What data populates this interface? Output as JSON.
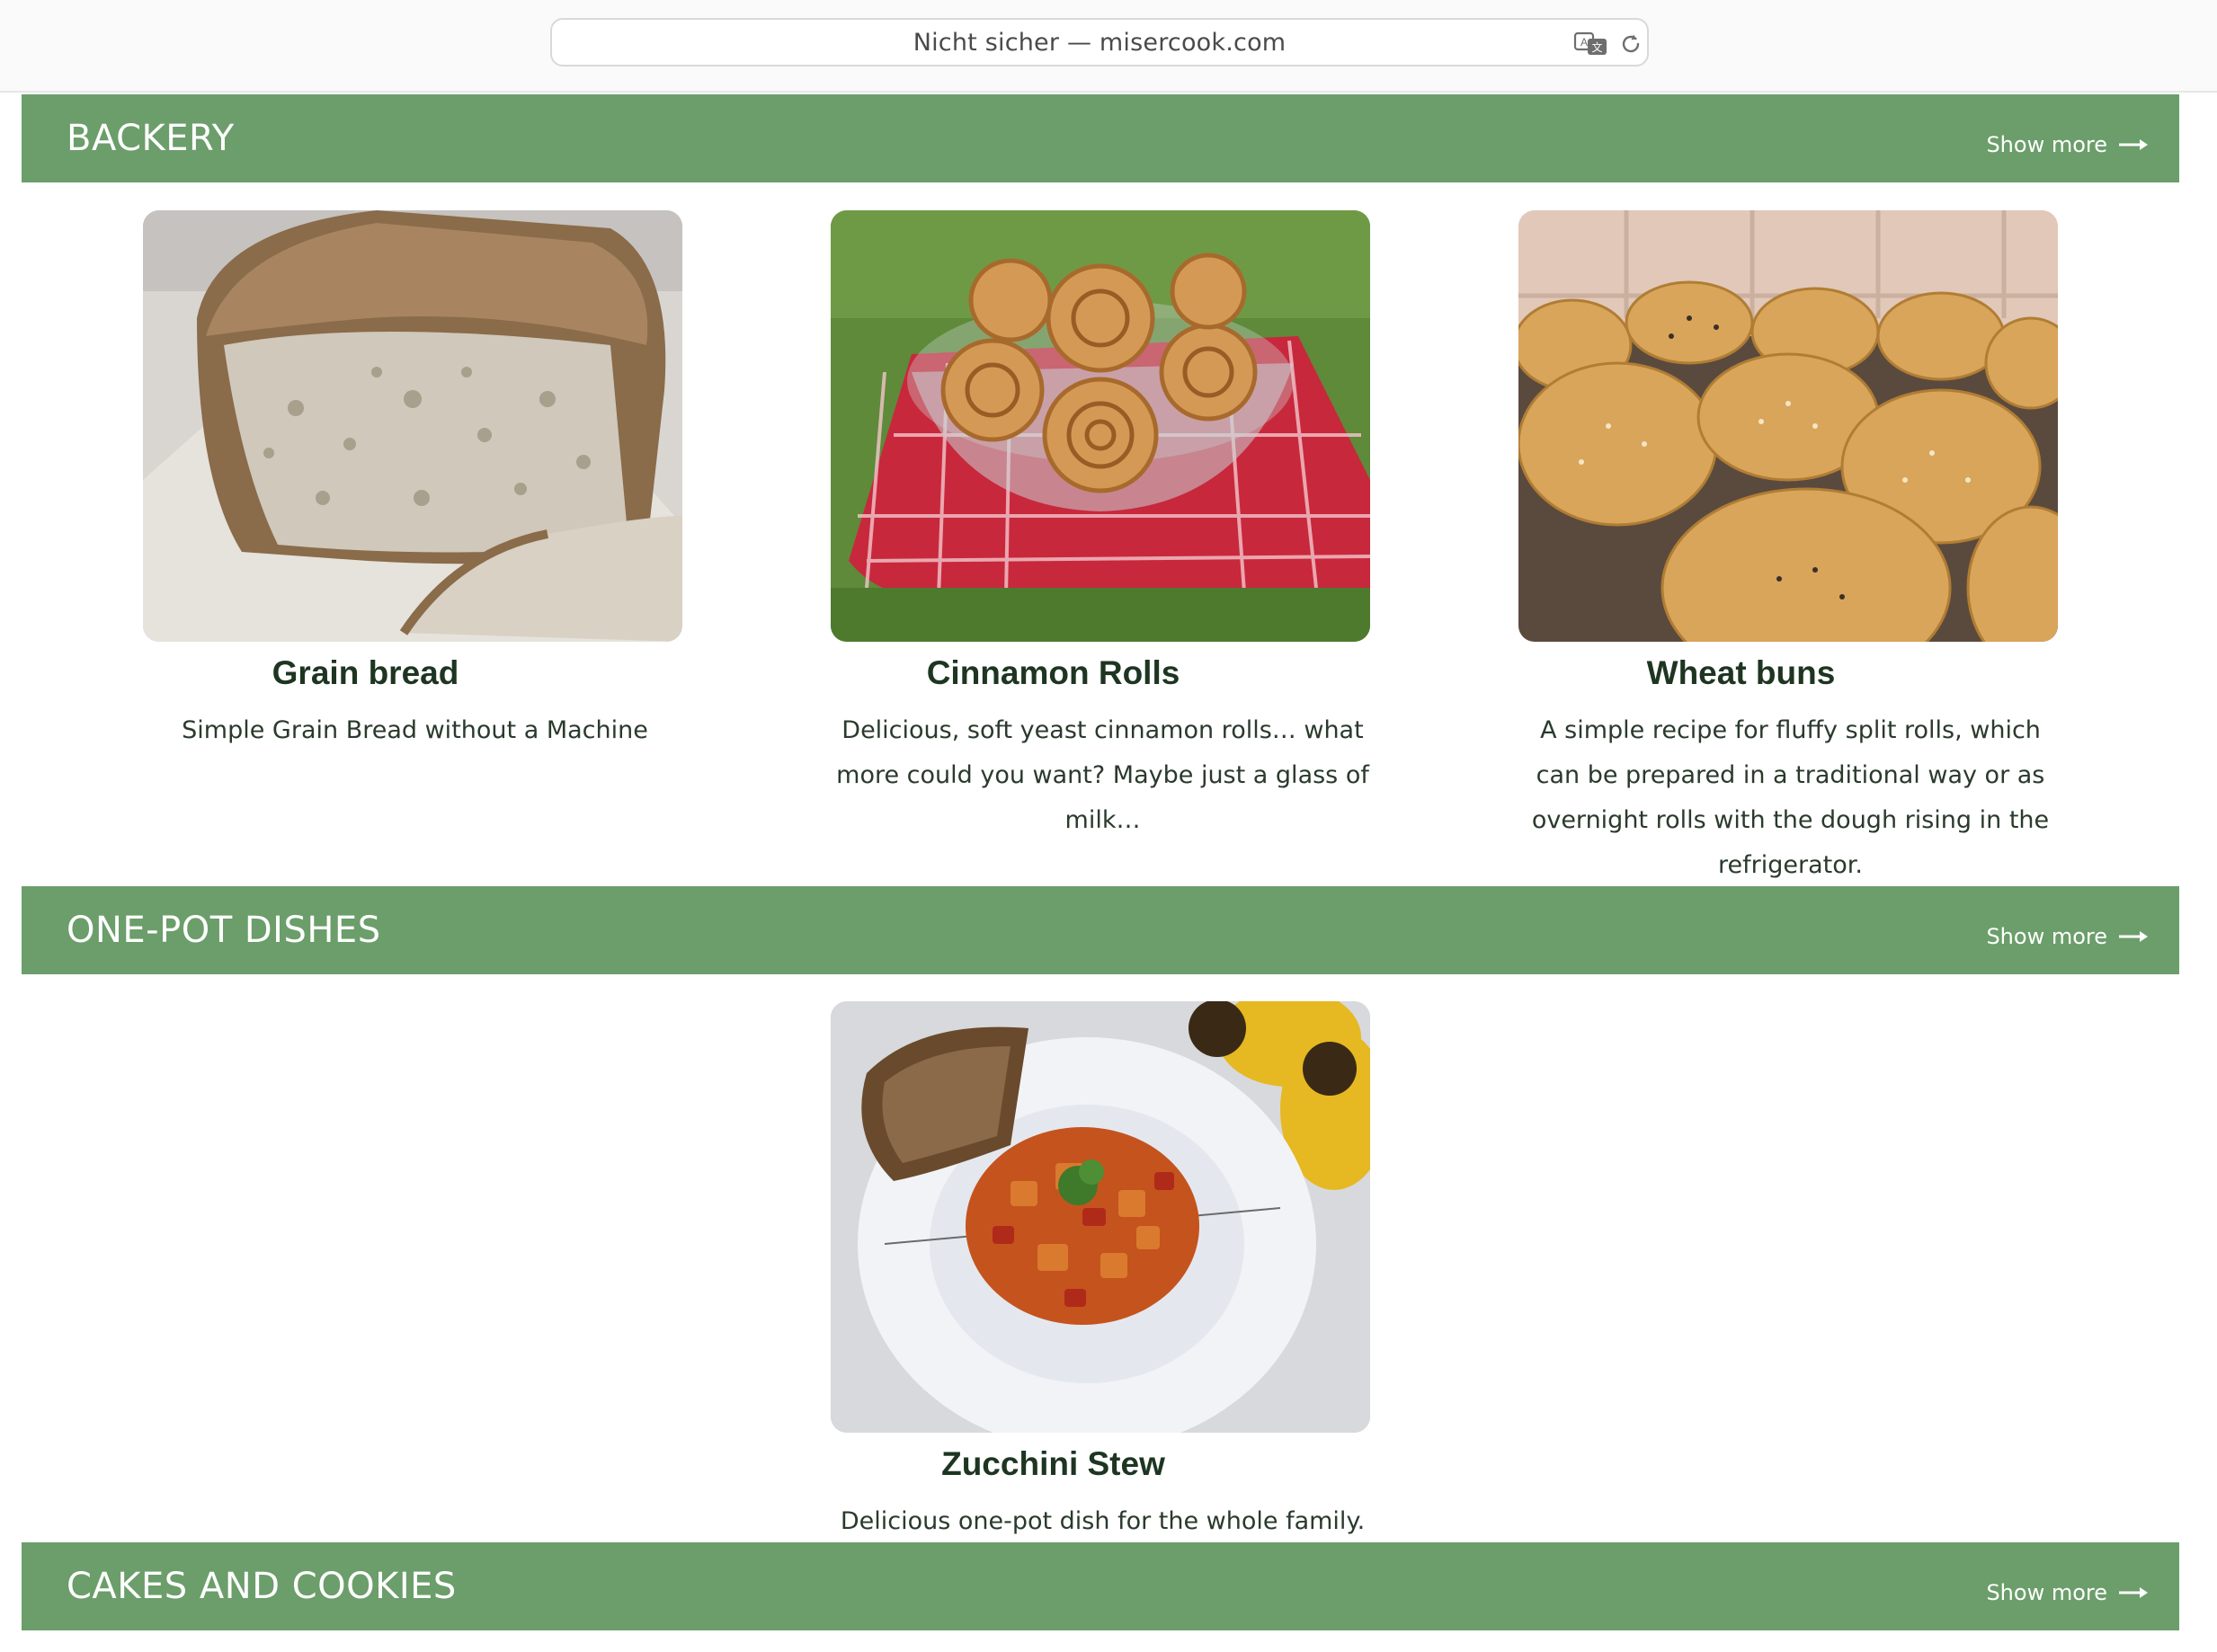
{
  "browser": {
    "address": "Nicht sicher — misercook.com"
  },
  "categories": [
    {
      "title": "BACKERY",
      "show_more": "Show more",
      "recipes": [
        {
          "title": "Grain bread",
          "description": "Simple Grain Bread without a Machine"
        },
        {
          "title": "Cinnamon Rolls",
          "description": "Delicious, soft yeast cinnamon rolls… what more could you want? Maybe just a glass of milk…"
        },
        {
          "title": "Wheat buns",
          "description": "A simple recipe for fluffy split rolls, which can be prepared in a traditional way or as overnight rolls with the dough rising in the refrigerator."
        }
      ]
    },
    {
      "title": "ONE-POT DISHES",
      "show_more": "Show more",
      "recipes": [
        {
          "title": "Zucchini Stew",
          "description": "Delicious one-pot dish for the whole family."
        }
      ]
    },
    {
      "title": "CAKES AND COOKIES",
      "show_more": "Show more",
      "recipes": []
    }
  ],
  "colors": {
    "category_bar": "#6b9e6a",
    "recipe_title": "#1d3521",
    "text": "#2a3a2c"
  },
  "icons": [
    "translate-icon",
    "reload-icon",
    "arrow-right-icon"
  ]
}
